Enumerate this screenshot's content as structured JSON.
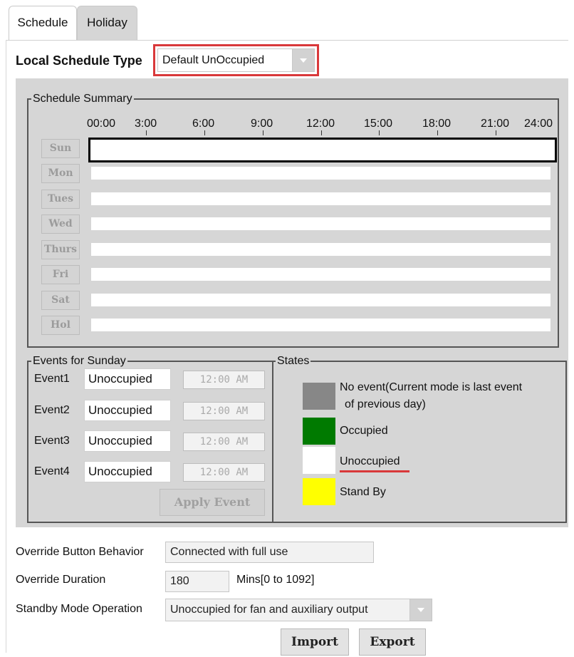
{
  "tabs": [
    {
      "label": "Schedule",
      "active": true
    },
    {
      "label": "Holiday",
      "active": false
    }
  ],
  "local_schedule_type": {
    "label": "Local Schedule Type",
    "value": "Default UnOccupied",
    "highlight_color": "#d9383a"
  },
  "schedule_summary": {
    "title": "Schedule Summary",
    "times": [
      "00:00",
      "3:00",
      "6:00",
      "9:00",
      "12:00",
      "15:00",
      "18:00",
      "21:00",
      "24:00"
    ],
    "days": [
      "Sun",
      "Mon",
      "Tues",
      "Wed",
      "Thurs",
      "Fri",
      "Sat",
      "Hol"
    ],
    "selected_day": "Sun"
  },
  "events": {
    "title": "Events for Sunday",
    "items": [
      {
        "label": "Event1",
        "state": "Unoccupied",
        "time": "12:00 AM"
      },
      {
        "label": "Event2",
        "state": "Unoccupied",
        "time": "12:00 AM"
      },
      {
        "label": "Event3",
        "state": "Unoccupied",
        "time": "12:00 AM"
      },
      {
        "label": "Event4",
        "state": "Unoccupied",
        "time": "12:00 AM"
      }
    ],
    "apply_label": "Apply Event"
  },
  "states": {
    "title": "States",
    "no_event_line1": "No event(Current mode is last event",
    "no_event_line2": "of previous day)",
    "occupied": "Occupied",
    "unoccupied": "Unoccupied",
    "standby": "Stand By",
    "colors": {
      "no_event": "#878787",
      "occupied": "#007a00",
      "unoccupied": "#ffffff",
      "standby": "#ffff00",
      "underline": "#d9383a"
    }
  },
  "override_button_behavior": {
    "label": "Override Button Behavior",
    "value": "Connected with full use"
  },
  "override_duration": {
    "label": "Override Duration",
    "value": "180",
    "unit": "Mins[0 to 1092]"
  },
  "standby_mode_operation": {
    "label": "Standby Mode Operation",
    "value": "Unoccupied for fan and auxiliary output"
  },
  "buttons": {
    "import": "Import",
    "export": "Export"
  }
}
